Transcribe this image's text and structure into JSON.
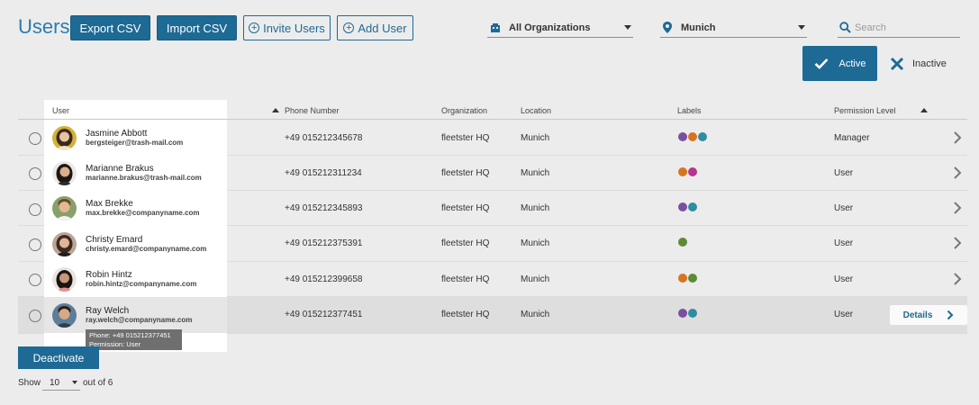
{
  "header": {
    "title": "Users",
    "export_csv": "Export CSV",
    "import_csv": "Import CSV",
    "invite_users": "Invite Users",
    "add_user": "Add User",
    "organization_filter": "All Organizations",
    "location_filter": "Munich",
    "search_placeholder": "Search"
  },
  "status_toggle": {
    "active_label": "Active",
    "inactive_label": "Inactive"
  },
  "table": {
    "columns": {
      "user": "User",
      "phone": "Phone Number",
      "organization": "Organization",
      "location": "Location",
      "labels": "Labels",
      "permission": "Permission Level"
    },
    "rows": [
      {
        "name": "Jasmine Abbott",
        "email": "bergsteiger@trash-mail.com",
        "phone": "+49 015212345678",
        "organization": "fleetster HQ",
        "location": "Munich",
        "labels": [
          "#7b4fa0",
          "#d9731e",
          "#2f8ca3"
        ],
        "permission": "Manager"
      },
      {
        "name": "Marianne Brakus",
        "email": "marianne.brakus@trash-mail.com",
        "phone": "+49 015212311234",
        "organization": "fleetster HQ",
        "location": "Munich",
        "labels": [
          "#d9731e",
          "#b5368c"
        ],
        "permission": "User"
      },
      {
        "name": "Max Brekke",
        "email": "max.brekke@companyname.com",
        "phone": "+49 015212345893",
        "organization": "fleetster HQ",
        "location": "Munich",
        "labels": [
          "#7b4fa0",
          "#2f8ca3"
        ],
        "permission": "User"
      },
      {
        "name": "Christy Emard",
        "email": "christy.emard@companyname.com",
        "phone": "+49 015212375391",
        "organization": "fleetster HQ",
        "location": "Munich",
        "labels": [
          "#5e8a35"
        ],
        "permission": "User"
      },
      {
        "name": "Robin Hintz",
        "email": "robin.hintz@companyname.com",
        "phone": "+49 015212399658",
        "organization": "fleetster HQ",
        "location": "Munich",
        "labels": [
          "#d9731e",
          "#5e8a35"
        ],
        "permission": "User"
      },
      {
        "name": "Ray Welch",
        "email": "ray.welch@companyname.com",
        "phone": "+49 015212377451",
        "organization": "fleetster HQ",
        "location": "Munich",
        "labels": [
          "#7b4fa0",
          "#2f8ca3"
        ],
        "permission": "User"
      }
    ]
  },
  "tooltip": {
    "phone_line": "Phone: +49 015212377451",
    "permission_line": "Permission: User"
  },
  "details_button": "Details",
  "deactivate_button": "Deactivate",
  "pagination": {
    "show_label": "Show",
    "page_size": "10",
    "out_of": "out of 6"
  },
  "colors": {
    "primary": "#1d6a95",
    "title_blue": "#2b7cb0",
    "background": "#ececec"
  }
}
